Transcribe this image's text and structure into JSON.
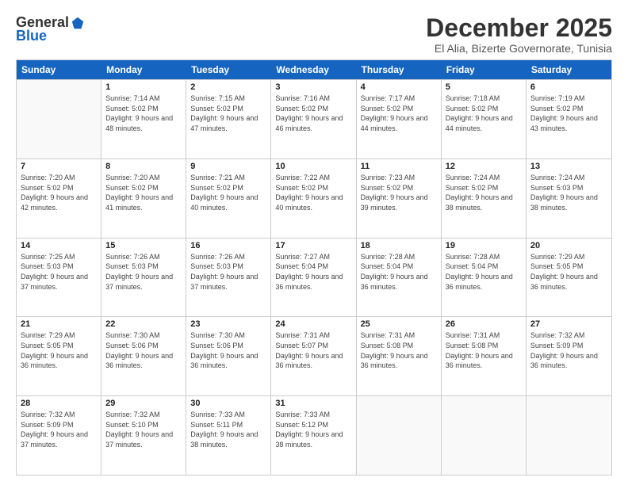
{
  "logo": {
    "general": "General",
    "blue": "Blue"
  },
  "title": "December 2025",
  "subtitle": "El Alia, Bizerte Governorate, Tunisia",
  "days": [
    "Sunday",
    "Monday",
    "Tuesday",
    "Wednesday",
    "Thursday",
    "Friday",
    "Saturday"
  ],
  "weeks": [
    [
      {
        "date": "",
        "sunrise": "",
        "sunset": "",
        "daylight": ""
      },
      {
        "date": "1",
        "sunrise": "7:14 AM",
        "sunset": "5:02 PM",
        "daylight": "9 hours and 48 minutes."
      },
      {
        "date": "2",
        "sunrise": "7:15 AM",
        "sunset": "5:02 PM",
        "daylight": "9 hours and 47 minutes."
      },
      {
        "date": "3",
        "sunrise": "7:16 AM",
        "sunset": "5:02 PM",
        "daylight": "9 hours and 46 minutes."
      },
      {
        "date": "4",
        "sunrise": "7:17 AM",
        "sunset": "5:02 PM",
        "daylight": "9 hours and 44 minutes."
      },
      {
        "date": "5",
        "sunrise": "7:18 AM",
        "sunset": "5:02 PM",
        "daylight": "9 hours and 44 minutes."
      },
      {
        "date": "6",
        "sunrise": "7:19 AM",
        "sunset": "5:02 PM",
        "daylight": "9 hours and 43 minutes."
      }
    ],
    [
      {
        "date": "7",
        "sunrise": "7:20 AM",
        "sunset": "5:02 PM",
        "daylight": "9 hours and 42 minutes."
      },
      {
        "date": "8",
        "sunrise": "7:20 AM",
        "sunset": "5:02 PM",
        "daylight": "9 hours and 41 minutes."
      },
      {
        "date": "9",
        "sunrise": "7:21 AM",
        "sunset": "5:02 PM",
        "daylight": "9 hours and 40 minutes."
      },
      {
        "date": "10",
        "sunrise": "7:22 AM",
        "sunset": "5:02 PM",
        "daylight": "9 hours and 40 minutes."
      },
      {
        "date": "11",
        "sunrise": "7:23 AM",
        "sunset": "5:02 PM",
        "daylight": "9 hours and 39 minutes."
      },
      {
        "date": "12",
        "sunrise": "7:24 AM",
        "sunset": "5:02 PM",
        "daylight": "9 hours and 38 minutes."
      },
      {
        "date": "13",
        "sunrise": "7:24 AM",
        "sunset": "5:03 PM",
        "daylight": "9 hours and 38 minutes."
      }
    ],
    [
      {
        "date": "14",
        "sunrise": "7:25 AM",
        "sunset": "5:03 PM",
        "daylight": "9 hours and 37 minutes."
      },
      {
        "date": "15",
        "sunrise": "7:26 AM",
        "sunset": "5:03 PM",
        "daylight": "9 hours and 37 minutes."
      },
      {
        "date": "16",
        "sunrise": "7:26 AM",
        "sunset": "5:03 PM",
        "daylight": "9 hours and 37 minutes."
      },
      {
        "date": "17",
        "sunrise": "7:27 AM",
        "sunset": "5:04 PM",
        "daylight": "9 hours and 36 minutes."
      },
      {
        "date": "18",
        "sunrise": "7:28 AM",
        "sunset": "5:04 PM",
        "daylight": "9 hours and 36 minutes."
      },
      {
        "date": "19",
        "sunrise": "7:28 AM",
        "sunset": "5:04 PM",
        "daylight": "9 hours and 36 minutes."
      },
      {
        "date": "20",
        "sunrise": "7:29 AM",
        "sunset": "5:05 PM",
        "daylight": "9 hours and 36 minutes."
      }
    ],
    [
      {
        "date": "21",
        "sunrise": "7:29 AM",
        "sunset": "5:05 PM",
        "daylight": "9 hours and 36 minutes."
      },
      {
        "date": "22",
        "sunrise": "7:30 AM",
        "sunset": "5:06 PM",
        "daylight": "9 hours and 36 minutes."
      },
      {
        "date": "23",
        "sunrise": "7:30 AM",
        "sunset": "5:06 PM",
        "daylight": "9 hours and 36 minutes."
      },
      {
        "date": "24",
        "sunrise": "7:31 AM",
        "sunset": "5:07 PM",
        "daylight": "9 hours and 36 minutes."
      },
      {
        "date": "25",
        "sunrise": "7:31 AM",
        "sunset": "5:08 PM",
        "daylight": "9 hours and 36 minutes."
      },
      {
        "date": "26",
        "sunrise": "7:31 AM",
        "sunset": "5:08 PM",
        "daylight": "9 hours and 36 minutes."
      },
      {
        "date": "27",
        "sunrise": "7:32 AM",
        "sunset": "5:09 PM",
        "daylight": "9 hours and 36 minutes."
      }
    ],
    [
      {
        "date": "28",
        "sunrise": "7:32 AM",
        "sunset": "5:09 PM",
        "daylight": "9 hours and 37 minutes."
      },
      {
        "date": "29",
        "sunrise": "7:32 AM",
        "sunset": "5:10 PM",
        "daylight": "9 hours and 37 minutes."
      },
      {
        "date": "30",
        "sunrise": "7:33 AM",
        "sunset": "5:11 PM",
        "daylight": "9 hours and 38 minutes."
      },
      {
        "date": "31",
        "sunrise": "7:33 AM",
        "sunset": "5:12 PM",
        "daylight": "9 hours and 38 minutes."
      },
      {
        "date": "",
        "sunrise": "",
        "sunset": "",
        "daylight": ""
      },
      {
        "date": "",
        "sunrise": "",
        "sunset": "",
        "daylight": ""
      },
      {
        "date": "",
        "sunrise": "",
        "sunset": "",
        "daylight": ""
      }
    ]
  ]
}
